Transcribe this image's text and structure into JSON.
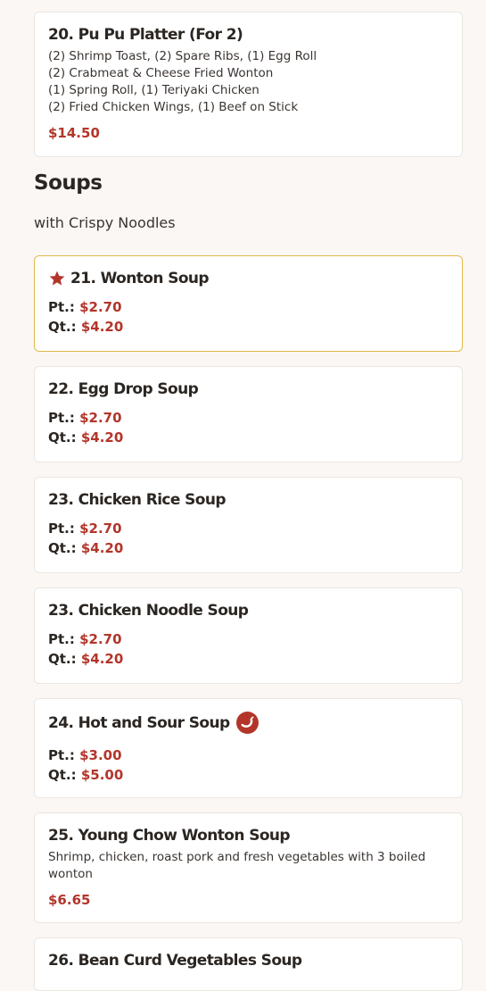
{
  "colors": {
    "accent_price": "#b3352a",
    "featured_border": "#e2b84a",
    "background": "#faf7f4"
  },
  "items": [
    {
      "title": "20. Pu Pu Platter (For 2)",
      "desc_lines": [
        "(2) Shrimp Toast, (2) Spare Ribs, (1) Egg Roll",
        "(2) Crabmeat & Cheese Fried Wonton",
        "(1) Spring Roll, (1) Teriyaki Chicken",
        "(2) Fried Chicken Wings, (1) Beef on Stick"
      ],
      "price": "$14.50"
    }
  ],
  "section": {
    "title": "Soups",
    "subtitle": "with Crispy Noodles"
  },
  "soups": [
    {
      "title": "21. Wonton Soup",
      "featured": true,
      "icon": "star-icon",
      "pt_label": "Pt.:",
      "pt": "$2.70",
      "qt_label": "Qt.:",
      "qt": "$4.20"
    },
    {
      "title": "22. Egg Drop Soup",
      "pt_label": "Pt.:",
      "pt": "$2.70",
      "qt_label": "Qt.:",
      "qt": "$4.20"
    },
    {
      "title": "23. Chicken Rice Soup",
      "pt_label": "Pt.:",
      "pt": "$2.70",
      "qt_label": "Qt.:",
      "qt": "$4.20"
    },
    {
      "title": "23. Chicken Noodle Soup",
      "pt_label": "Pt.:",
      "pt": "$2.70",
      "qt_label": "Qt.:",
      "qt": "$4.20"
    },
    {
      "title": "24. Hot and Sour Soup",
      "icon": "spicy-chili-icon",
      "pt_label": "Pt.:",
      "pt": "$3.00",
      "qt_label": "Qt.:",
      "qt": "$5.00"
    },
    {
      "title": "25. Young Chow Wonton Soup",
      "desc": "Shrimp, chicken, roast pork and fresh vegetables with 3 boiled wonton",
      "price": "$6.65"
    },
    {
      "title": "26. Bean Curd Vegetables Soup"
    }
  ]
}
